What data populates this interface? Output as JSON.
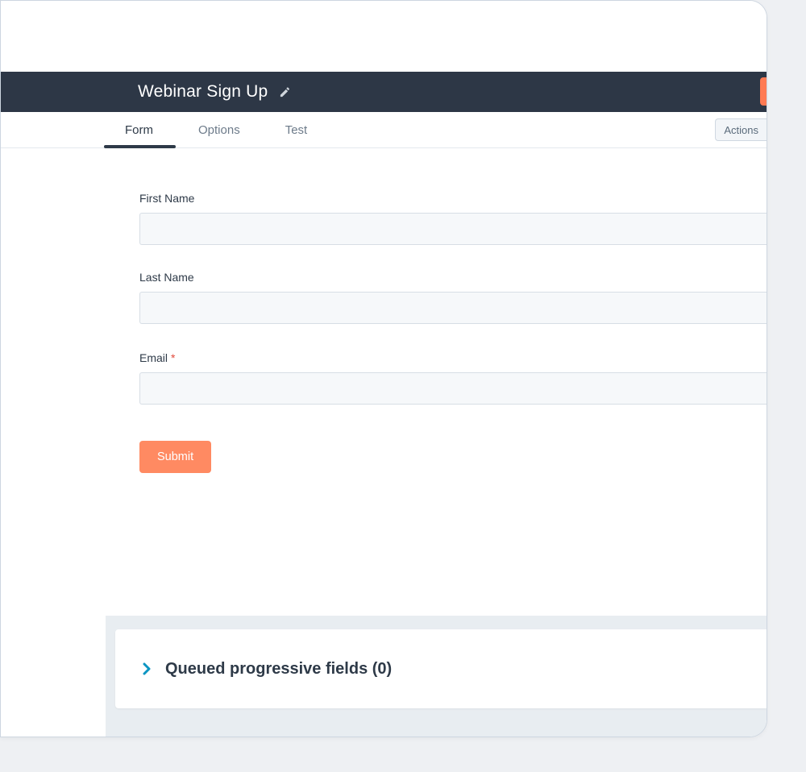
{
  "header": {
    "title": "Webinar Sign Up"
  },
  "tabs": {
    "form": "Form",
    "options": "Options",
    "test": "Test"
  },
  "actions_label": "Actions",
  "fields": {
    "first_name": {
      "label": "First Name",
      "value": ""
    },
    "last_name": {
      "label": "Last Name",
      "value": ""
    },
    "email": {
      "label": "Email",
      "value": "",
      "required": true
    }
  },
  "submit_label": "Submit",
  "queued": {
    "label": "Queued progressive fields (0)",
    "count": 0
  },
  "colors": {
    "dark_bar": "#2d3746",
    "accent_orange": "#ff8a62",
    "link_blue": "#0a95c2",
    "text_primary": "#2e3a48",
    "text_muted": "#6d7b8a"
  }
}
